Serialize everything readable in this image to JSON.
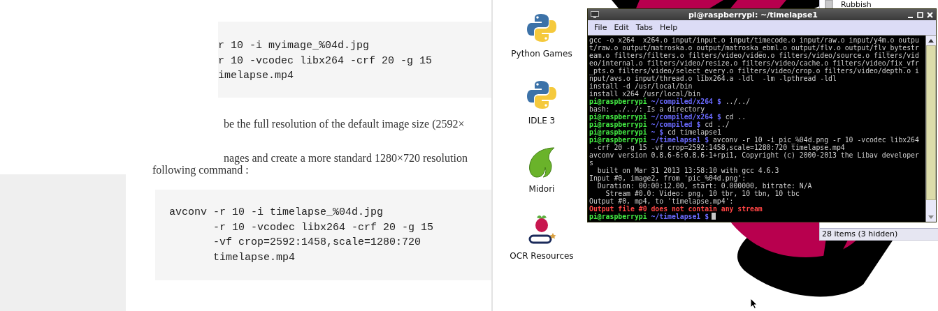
{
  "article_top": {
    "code_lines": [
      "r 10 -i myimage_%04d.jpg",
      "r 10 -vcodec libx264 -crf 20 -g 15",
      "imelapse.mp4"
    ],
    "paragraphs": [
      "be the full resolution of the default image size (2592×",
      "nages and create a more standard 1280×720 resolution"
    ]
  },
  "article_bottom": {
    "paragraph": "following command :",
    "code": {
      "command": "avconv",
      "args": [
        "-r 10 -i timelapse_%04d.jpg",
        "-r 10 -vcodec libx264 -crf 20 -g 15",
        "-vf crop=2592:1458,scale=1280:720",
        "timelapse.mp4"
      ]
    }
  },
  "desktop_icons": [
    {
      "kind": "python",
      "label": "Python Games"
    },
    {
      "kind": "python",
      "label": "IDLE 3"
    },
    {
      "kind": "midori",
      "label": "Midori"
    },
    {
      "kind": "ocr",
      "label": "OCR Resources"
    }
  ],
  "file_manager": {
    "items": [
      {
        "label": "Rubbish"
      }
    ],
    "status": "28 items (3 hidden)"
  },
  "terminal": {
    "title": "pi@raspberrypi: ~/timelapse1",
    "menu": [
      "File",
      "Edit",
      "Tabs",
      "Help"
    ],
    "lines": [
      {
        "kind": "output",
        "text": "gcc -o x264  x264.o input/input.o input/timecode.o input/raw.o input/y4m.o outpu"
      },
      {
        "kind": "output",
        "text": "t/raw.o output/matroska.o output/matroska_ebml.o output/flv.o output/flv_bytestr"
      },
      {
        "kind": "output",
        "text": "eam.o filters/filters.o filters/video/video.o filters/video/source.o filters/vid"
      },
      {
        "kind": "output",
        "text": "eo/internal.o filters/video/resize.o filters/video/cache.o filters/video/fix_vfr"
      },
      {
        "kind": "output",
        "text": "_pts.o filters/video/select_every.o filters/video/crop.o filters/video/depth.o i"
      },
      {
        "kind": "output",
        "text": "nput/avs.o input/thread.o libx264.a -ldl  -lm -lpthread -ldl"
      },
      {
        "kind": "output",
        "text": "install -d /usr/local/bin"
      },
      {
        "kind": "output",
        "text": "install x264 /usr/local/bin"
      },
      {
        "kind": "prompt",
        "user": "pi@raspberrypi",
        "path": "~/compiled/x264",
        "symbol": "$",
        "command": "../../"
      },
      {
        "kind": "output",
        "text": "bash: ../../: Is a directory"
      },
      {
        "kind": "prompt",
        "user": "pi@raspberrypi",
        "path": "~/compiled/x264",
        "symbol": "$",
        "command": "cd .."
      },
      {
        "kind": "prompt",
        "user": "pi@raspberrypi",
        "path": "~/compiled",
        "symbol": "$",
        "command": "cd ../"
      },
      {
        "kind": "prompt",
        "user": "pi@raspberrypi",
        "path": "~",
        "symbol": "$",
        "command": "cd timelapse1"
      },
      {
        "kind": "prompt",
        "user": "pi@raspberrypi",
        "path": "~/timelapse1",
        "symbol": "$",
        "command": "avconv -r 10 -i pic_%04d.png -r 10 -vcodec libx264"
      },
      {
        "kind": "output",
        "text": " -crf 20 -g 15 -vf crop=2592:1458,scale=1280:720 timelapse.mp4"
      },
      {
        "kind": "output",
        "text": "avconv version 0.8.6-6:0.8.6-1+rpi1, Copyright (c) 2000-2013 the Libav developer"
      },
      {
        "kind": "output",
        "text": "s"
      },
      {
        "kind": "output",
        "text": "  built on Mar 31 2013 13:58:10 with gcc 4.6.3"
      },
      {
        "kind": "output",
        "text": "Input #0, image2, from 'pic_%04d.png':"
      },
      {
        "kind": "output",
        "text": "  Duration: 00:00:12.00, start: 0.000000, bitrate: N/A"
      },
      {
        "kind": "output",
        "text": "    Stream #0.0: Video: png, 10 tbr, 10 tbn, 10 tbc"
      },
      {
        "kind": "output",
        "text": "Output #0, mp4, to 'timelapse.mp4':"
      },
      {
        "kind": "error",
        "text": "Output file #0 does not contain any stream"
      },
      {
        "kind": "prompt",
        "user": "pi@raspberrypi",
        "path": "~/timelapse1",
        "symbol": "$"
      }
    ]
  }
}
